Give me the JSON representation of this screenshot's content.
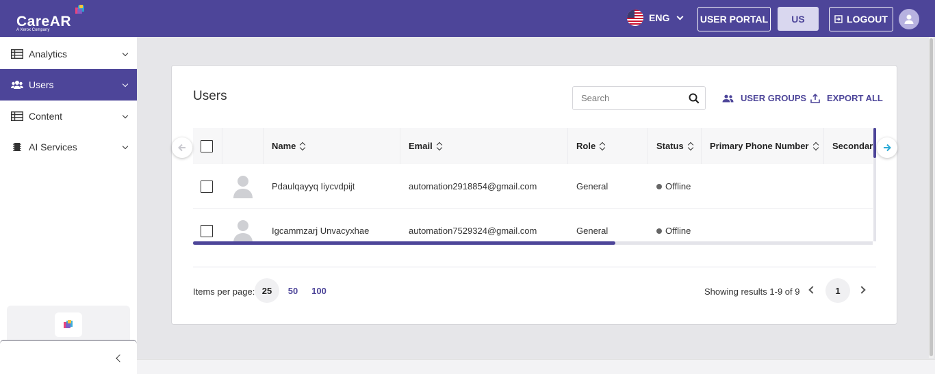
{
  "header": {
    "logo_text": "CareAR",
    "logo_sub": "A Xerox Company",
    "language": "ENG",
    "user_portal_label": "USER PORTAL",
    "region_label": "US",
    "logout_label": "LOGOUT"
  },
  "sidebar": {
    "items": [
      {
        "label": "Analytics",
        "icon": "table-icon"
      },
      {
        "label": "Users",
        "icon": "users-icon",
        "active": true
      },
      {
        "label": "Content",
        "icon": "table-icon"
      },
      {
        "label": "AI Services",
        "icon": "chip-icon"
      }
    ]
  },
  "main": {
    "title": "Users",
    "search_placeholder": "Search",
    "user_groups_label": "USER GROUPS",
    "export_all_label": "EXPORT ALL"
  },
  "table": {
    "columns": [
      "Name",
      "Email",
      "Role",
      "Status",
      "Primary Phone Number",
      "Secondary"
    ],
    "rows": [
      {
        "name": "Pdaulqayyq Iiycvdpijt",
        "email": "automation2918854@gmail.com",
        "role": "General",
        "status": "Offline"
      },
      {
        "name": "Igcammzarj Unvacyxhae",
        "email": "automation7529324@gmail.com",
        "role": "General",
        "status": "Offline"
      }
    ]
  },
  "pagination": {
    "items_per_page_label": "Items per page:",
    "options": [
      "25",
      "50",
      "100"
    ],
    "selected": "25",
    "showing": "Showing results 1-9 of 9",
    "current_page": "1"
  },
  "colors": {
    "brand": "#4d4599",
    "accent": "#29a9d6"
  }
}
